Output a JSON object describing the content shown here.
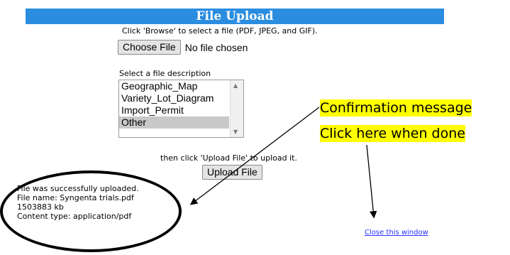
{
  "header": {
    "title": "File Upload",
    "color": "#2b8de0"
  },
  "instructions": "Click 'Browse' to select a file (PDF, JPEG, and GIF).",
  "file_input": {
    "button_label": "Choose File",
    "status": "No file chosen"
  },
  "description": {
    "label": "Select a file description",
    "options": [
      "Geographic_Map",
      "Variety_Lot_Diagram",
      "Import_Permit",
      "Other"
    ],
    "selected": "Other"
  },
  "upload": {
    "instruction": "then click 'Upload File' to upload it.",
    "button_label": "Upload File"
  },
  "confirmation": {
    "line1": "File was successfully uploaded.",
    "line2": "File name: Syngenta trials.pdf",
    "line3": "1503883 kb",
    "line4": "Content type: application/pdf"
  },
  "annotations": {
    "callout1": "Confirmation message",
    "callout2": "Click here when done",
    "highlight_color": "#ffff00"
  },
  "close_link": "Close this window"
}
